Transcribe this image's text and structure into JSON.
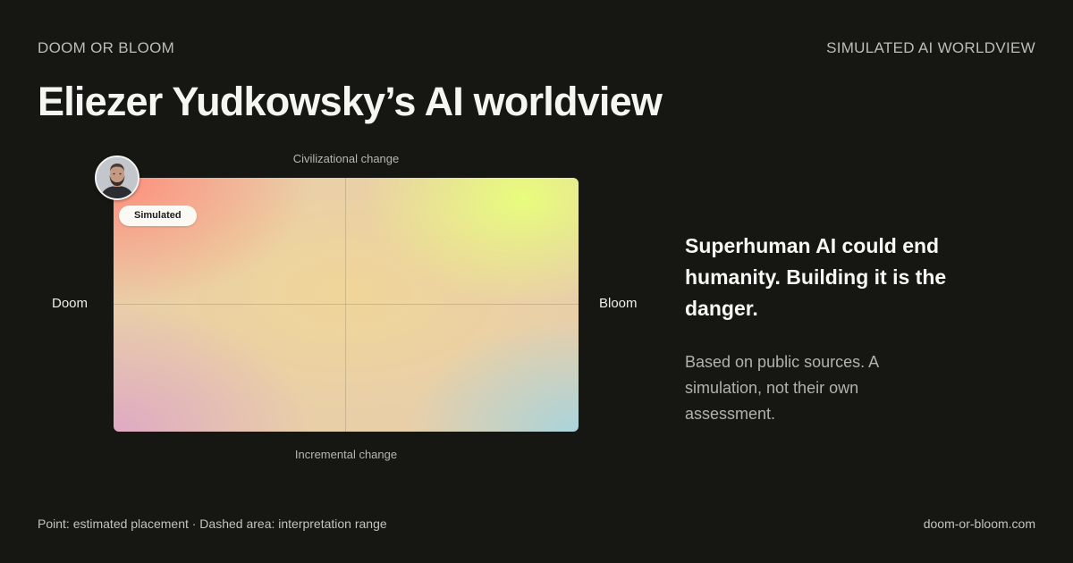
{
  "header": {
    "brand": "DOOM OR BLOOM",
    "tag": "SIMULATED AI WORLDVIEW",
    "title": "Eliezer Yudkowsky’s AI worldview"
  },
  "chart": {
    "axis_top": "Civilizational change",
    "axis_bottom": "Incremental change",
    "axis_left": "Doom",
    "axis_right": "Bloom",
    "badge": "Simulated",
    "avatar_icon": "person-avatar-icon",
    "placement": {
      "doom_bloom": 0.0,
      "incremental_civilizational": 1.0
    }
  },
  "summary": {
    "headline": "Superhuman AI could end humanity. Building it is the danger.",
    "note": "Based on public sources. A simulation, not their own assessment."
  },
  "footer": {
    "legend": "Point: estimated placement · Dashed area: interpretation range",
    "site": "doom-or-bloom.com"
  },
  "colors": {
    "background": "#161613",
    "doom_civilizational": "#ff8a7a",
    "bloom_civilizational": "#e8ff7a",
    "doom_incremental": "#dea8c4",
    "bloom_incremental": "#a6d4de"
  }
}
